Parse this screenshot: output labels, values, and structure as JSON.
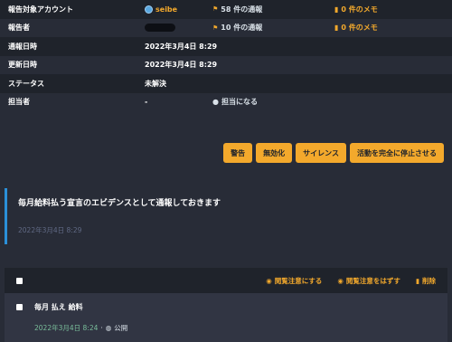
{
  "report_info": {
    "target_account": {
      "label": "報告対象アカウント",
      "username": "seibe",
      "reports": "58 件の通報",
      "notes": "0 件のメモ"
    },
    "reporter": {
      "label": "報告者",
      "reports": "10 件の通報",
      "notes": "0 件のメモ"
    },
    "reported_at": {
      "label": "通報日時",
      "value": "2022年3月4日 8:29"
    },
    "updated_at": {
      "label": "更新日時",
      "value": "2022年3月4日 8:29"
    },
    "status": {
      "label": "ステータス",
      "value": "未解決"
    },
    "assignee": {
      "label": "担当者",
      "value": "-",
      "assign_action": "担当になる"
    }
  },
  "actions": {
    "warn": "警告",
    "disable": "無効化",
    "silence": "サイレンス",
    "suspend": "活動を完全に停止させる"
  },
  "comment": {
    "text": "毎月給料払う宣言のエビデンスとして通報しておきます",
    "date": "2022年3月4日 8:29"
  },
  "statuses": {
    "mark_sensitive": "閲覧注意にする",
    "unmark_sensitive": "閲覧注意をはずす",
    "delete": "削除",
    "items": [
      {
        "content": "毎月 払え 給料",
        "date": "2022年3月4日 8:24",
        "visibility": "公開"
      }
    ]
  },
  "colors": {
    "accent": "#f3a92c",
    "link_blue": "#2b90d9",
    "green": "#79bd9a",
    "bg": "#282c37"
  }
}
